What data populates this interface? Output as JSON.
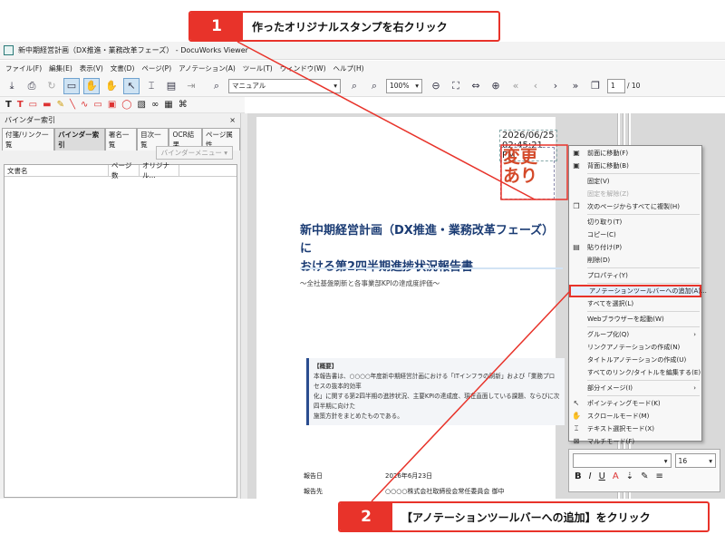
{
  "callouts": [
    {
      "number": "1",
      "text": "作ったオリジナルスタンプを右クリック"
    },
    {
      "number": "2",
      "text": "【アノテーションツールバーへの追加】をクリック"
    }
  ],
  "window": {
    "title": "新中期経営計画（DX推進・業務改革フェーズ） - DocuWorks Viewer"
  },
  "menu": [
    "ファイル(F)",
    "編集(E)",
    "表示(V)",
    "文書(D)",
    "ページ(P)",
    "アノテーション(A)",
    "ツール(T)",
    "ウィンドウ(W)",
    "ヘルプ(H)"
  ],
  "toolbar": {
    "search_value": "マニュアル",
    "zoom_value": "100%",
    "page_current": "1",
    "page_total": "/ 10"
  },
  "panel": {
    "title": "バインダー索引",
    "close": "×",
    "tabs": [
      "付箋/リンク一覧",
      "バインダー索引",
      "署名一覧",
      "目次一覧",
      "OCR結果",
      "ページ属性"
    ],
    "active_tab": 1,
    "binder_menu_label": "バインダーメニュー ▾",
    "columns": [
      "文書名",
      "ページ数",
      "オリジナル..."
    ]
  },
  "document": {
    "timestamp": "2026/06/25 02:45:21 PM",
    "stamp_line1": "変更",
    "stamp_line2": "あり",
    "heading_line1": "新中期経営計画（DX推進・業務改革フェーズ）に",
    "heading_line2": "おける第2四半期進捗状況報告書",
    "subtitle": "〜全社基盤刷新と各事業部KPIの達成度評価〜",
    "summary_title": "【概要】",
    "summary_line1": "本報告書は、○○○○年度新中期経営計画における「ITインフラの刷新」および「業務プロセスの抜本的効率",
    "summary_line2": "化」に関する第2四半期の進捗状況、主要KPIの達成度、現在直面している課題、ならびに次四半期に向けた",
    "summary_line3": "施策方針をまとめたものである。",
    "date_label": "報告日",
    "date_value": "2026年6月23日",
    "to_label": "報告先",
    "to_value": "○○○○株式会社取締役会常任委員会 御中"
  },
  "context_menu": {
    "items": [
      {
        "label": "前面に移動(F)",
        "icon": "bring-front-icon",
        "disabled": false,
        "sep_after": false
      },
      {
        "label": "背面に移動(B)",
        "icon": "send-back-icon",
        "disabled": false,
        "sep_after": true
      },
      {
        "label": "固定(V)",
        "icon": "",
        "disabled": false,
        "sep_after": false
      },
      {
        "label": "固定を解除(Z)",
        "icon": "",
        "disabled": true,
        "sep_after": false
      },
      {
        "label": "次のページからすべてに複製(H)",
        "icon": "duplicate-icon",
        "disabled": false,
        "sep_after": true
      },
      {
        "label": "切り取り(T)",
        "icon": "",
        "disabled": false,
        "sep_after": false
      },
      {
        "label": "コピー(C)",
        "icon": "",
        "disabled": false,
        "sep_after": false
      },
      {
        "label": "貼り付け(P)",
        "icon": "paste-icon",
        "disabled": false,
        "sep_after": false
      },
      {
        "label": "削除(D)",
        "icon": "",
        "disabled": false,
        "sep_after": true
      },
      {
        "label": "プロパティ(Y)",
        "icon": "",
        "disabled": false,
        "sep_after": true
      },
      {
        "label": "アノテーションツールバーへの追加(A)...",
        "icon": "",
        "disabled": false,
        "sep_after": false,
        "highlight": true
      },
      {
        "label": "すべてを選択(L)",
        "icon": "",
        "disabled": false,
        "sep_after": true
      },
      {
        "label": "Webブラウザーを起動(W)",
        "icon": "",
        "disabled": false,
        "sep_after": true
      },
      {
        "label": "グループ化(Q)",
        "icon": "",
        "disabled": false,
        "sep_after": false,
        "submenu": true
      },
      {
        "label": "リンクアノテーションの作成(N)",
        "icon": "",
        "disabled": false,
        "sep_after": false
      },
      {
        "label": "タイトルアノテーションの作成(U)",
        "icon": "",
        "disabled": false,
        "sep_after": false
      },
      {
        "label": "すべてのリンク/タイトルを編集する(E)",
        "icon": "",
        "disabled": false,
        "sep_after": true
      },
      {
        "label": "部分イメージ(I)",
        "icon": "",
        "disabled": false,
        "sep_after": true,
        "submenu": true
      },
      {
        "label": "ポインティングモード(K)",
        "icon": "pointer-icon",
        "disabled": false,
        "sep_after": false
      },
      {
        "label": "スクロールモード(M)",
        "icon": "hand-icon",
        "disabled": false,
        "sep_after": false
      },
      {
        "label": "テキスト選択モード(X)",
        "icon": "text-select-icon",
        "disabled": false,
        "sep_after": false
      },
      {
        "label": "マルチモード(F)",
        "icon": "multi-mode-icon",
        "disabled": false,
        "sep_after": false
      }
    ]
  },
  "mini_toolbar": {
    "font_size": "16",
    "buttons": [
      "B",
      "I",
      "U",
      "A",
      "⇣",
      "✎",
      "≡"
    ]
  },
  "colors": {
    "accent": "#e8332a",
    "heading": "#1b3c74"
  }
}
